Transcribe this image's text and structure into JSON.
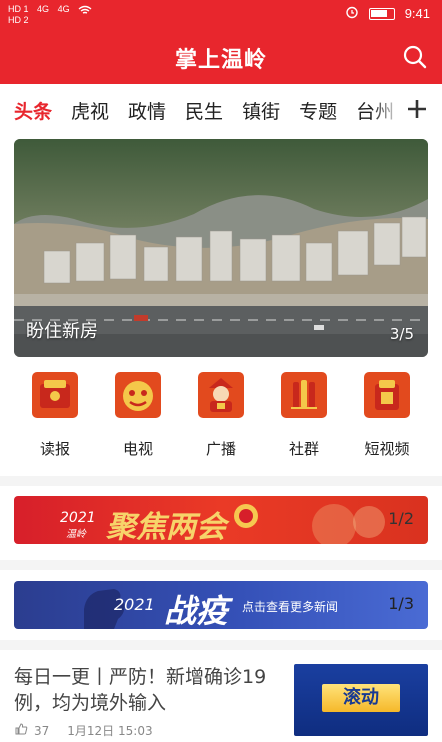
{
  "status_bar": {
    "sim1": "HD 1",
    "sim2": "HD 2",
    "network1": "4G",
    "network2": "4G",
    "time": "9:41"
  },
  "header": {
    "title": "掌上温岭",
    "search_icon": "search-icon"
  },
  "tabs": [
    {
      "label": "头条",
      "active": true
    },
    {
      "label": "虎视",
      "active": false
    },
    {
      "label": "政情",
      "active": false
    },
    {
      "label": "民生",
      "active": false
    },
    {
      "label": "镇街",
      "active": false
    },
    {
      "label": "专题",
      "active": false
    },
    {
      "label": "台州",
      "active": false
    }
  ],
  "tabs_more_icon": "plus-icon",
  "banner": {
    "caption": "盼住新房",
    "counter": "3/5"
  },
  "quick_links": [
    {
      "label": "读报",
      "icon": "newspaper-icon"
    },
    {
      "label": "电视",
      "icon": "tv-icon"
    },
    {
      "label": "广播",
      "icon": "radio-icon"
    },
    {
      "label": "社群",
      "icon": "community-icon"
    },
    {
      "label": "短视频",
      "icon": "short-video-icon"
    }
  ],
  "promo1": {
    "year": "2021",
    "place": "温岭",
    "headline": "聚焦两会",
    "counter": "1/2"
  },
  "promo2": {
    "year": "2021",
    "headline": "战疫",
    "subtitle": "点击查看更多新闻",
    "counter": "1/3"
  },
  "news": {
    "title": "每日一更丨严防！新增确诊19例，均为境外输入",
    "likes": "37",
    "date": "1月12日 15:03",
    "thumb_label": "滚动"
  },
  "colors": {
    "brand_red": "#e8262d",
    "active_tab": "#e8262d",
    "promo_blue": "#3551b8"
  }
}
